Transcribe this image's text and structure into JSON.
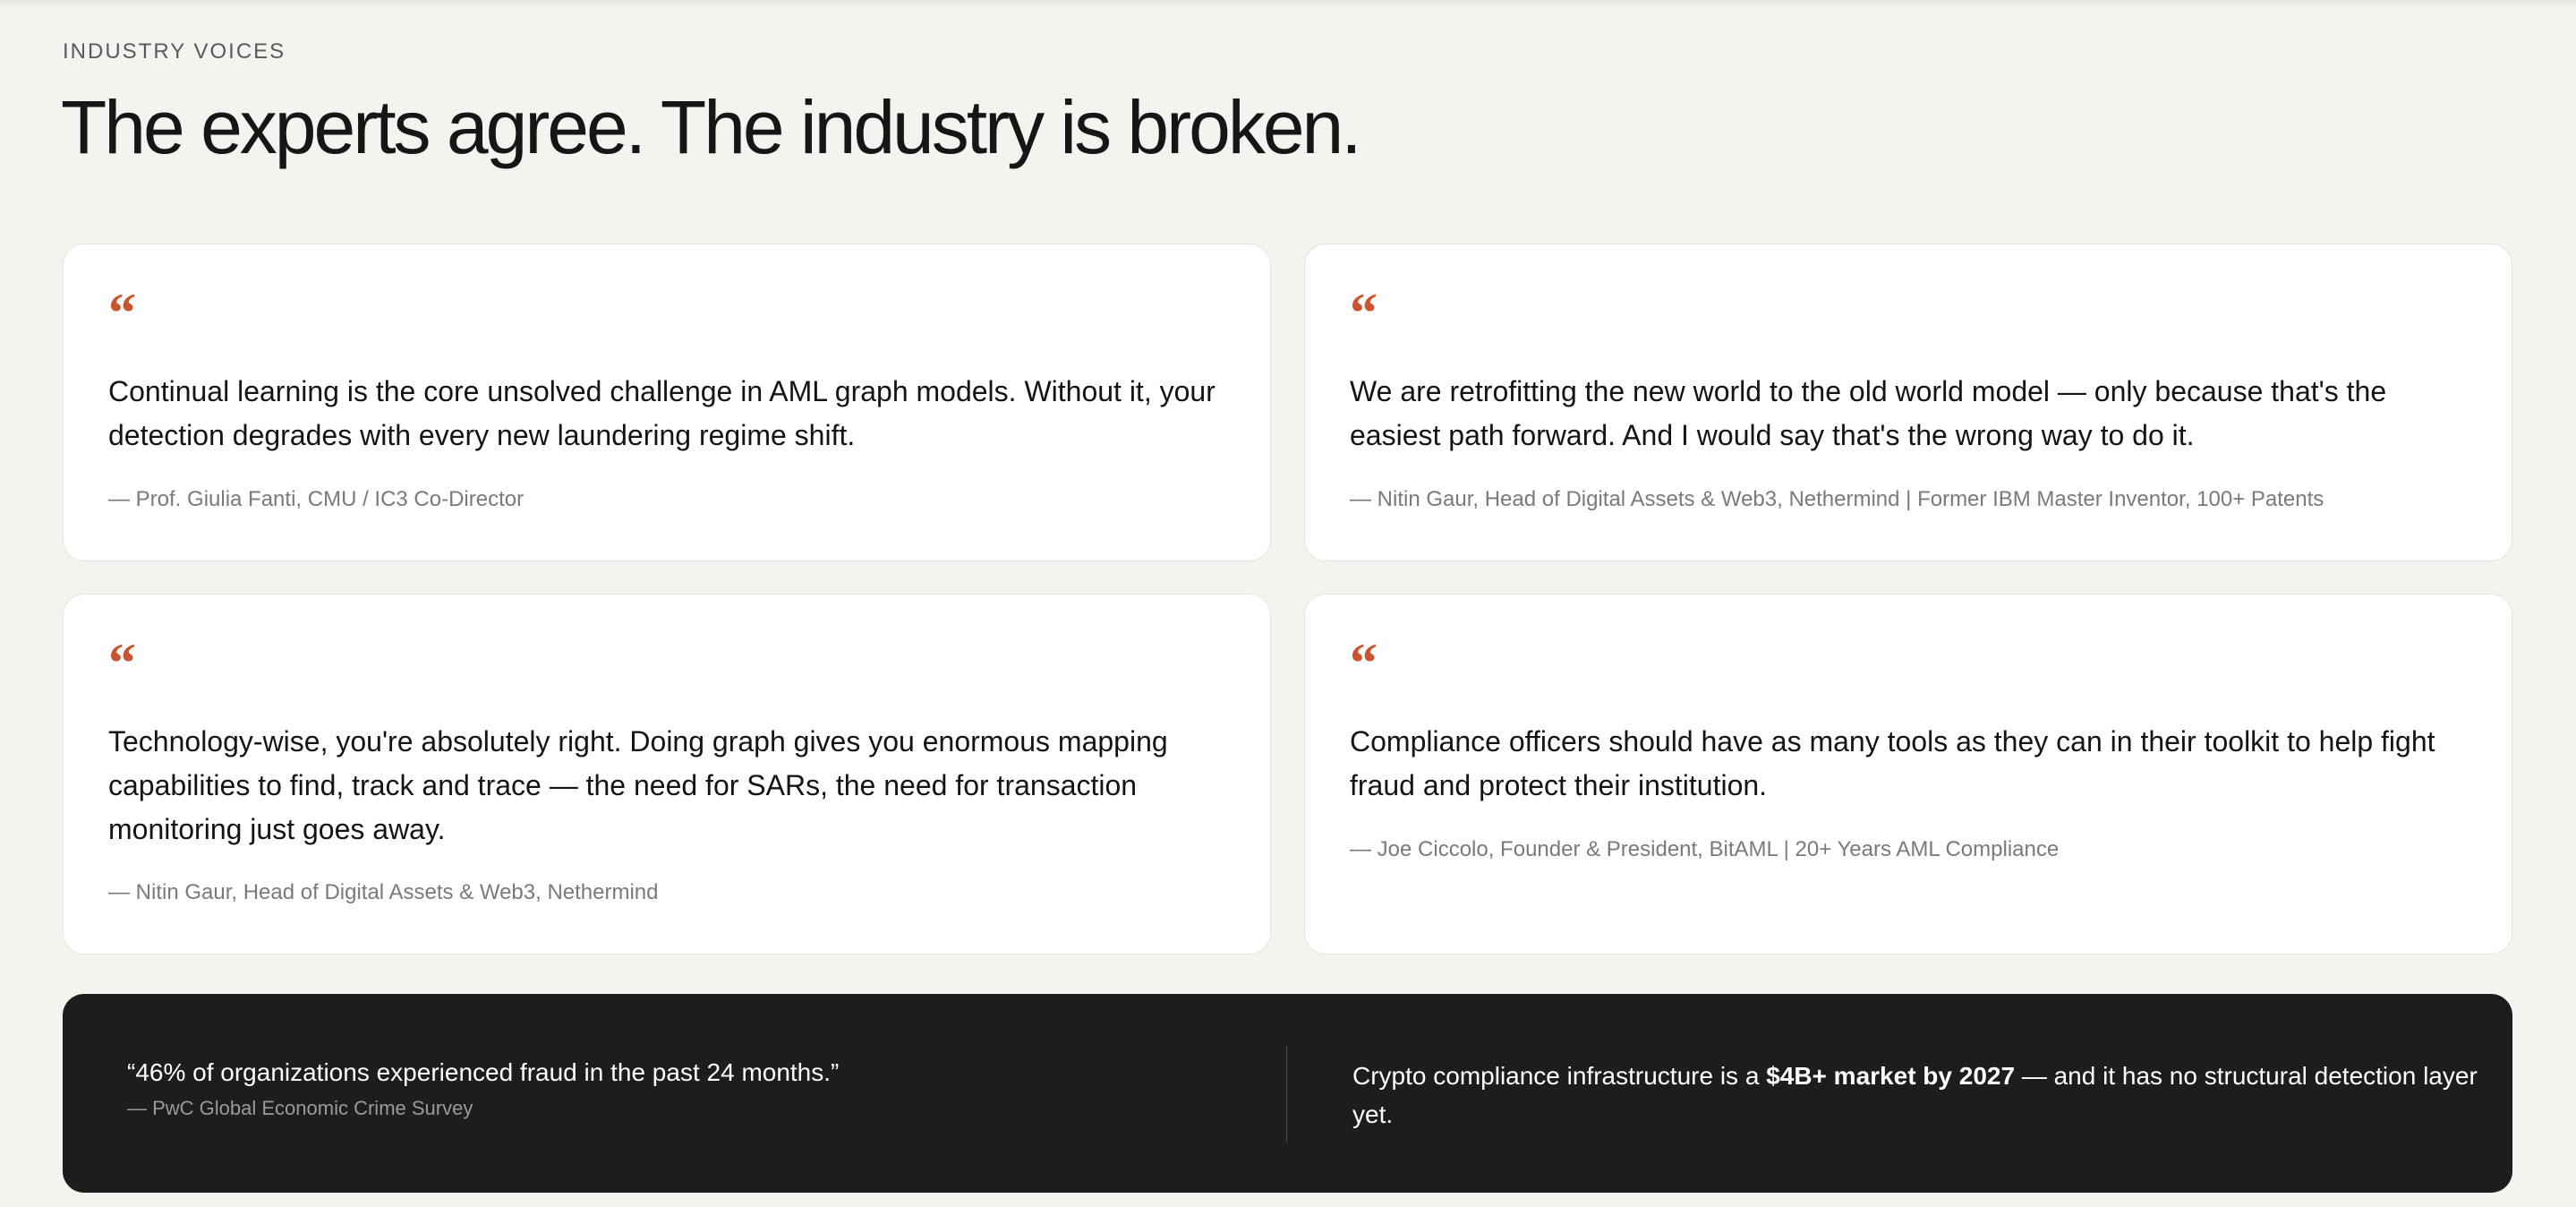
{
  "section": {
    "eyebrow": "INDUSTRY VOICES",
    "headline": "The experts agree. The industry is broken."
  },
  "testimonials": [
    {
      "quote": "Continual learning is the core unsolved challenge in AML graph models. Without it, your detection degrades with every new laundering regime shift.",
      "author": "— Prof. Giulia Fanti, CMU / IC3 Co-Director"
    },
    {
      "quote": "We are retrofitting the new world to the old world model — only because that's the easiest path forward. And I would say that's the wrong way to do it.",
      "author": "— Nitin Gaur, Head of Digital Assets & Web3, Nethermind | Former IBM Master Inventor, 100+ Patents"
    },
    {
      "quote": "Technology-wise, you're absolutely right. Doing graph gives you enormous mapping capabilities to find, track and trace — the need for SARs, the need for transaction monitoring just goes away.",
      "author": "— Nitin Gaur, Head of Digital Assets & Web3, Nethermind"
    },
    {
      "quote": "Compliance officers should have as many tools as they can in their toolkit to help fight fraud and protect their institution.",
      "author": "— Joe Ciccolo, Founder & President, BitAML | 20+ Years AML Compliance"
    }
  ],
  "quote_mark": "“",
  "stats": {
    "left_quote": "“46% of organizations experienced fraud in the past 24 months.”",
    "left_source": "— PwC Global Economic Crime Survey",
    "right_before": "Crypto compliance infrastructure is a ",
    "right_bold": "$4B+ market by 2027",
    "right_after": " — and it has no structural detection layer yet."
  },
  "colors": {
    "background": "#f4f3ef",
    "accent": "#c8552f",
    "dark_panel": "#1d1d1d"
  },
  "icons": {
    "quote_icon": "left-double-quotation-mark"
  }
}
